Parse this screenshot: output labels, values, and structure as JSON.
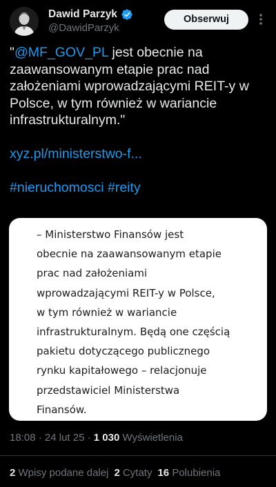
{
  "author": {
    "display_name": "Dawid Parzyk",
    "handle": "@DawidParzyk",
    "verified_color": "#1d9bf0"
  },
  "follow_button": {
    "label": "Obserwuj"
  },
  "more_icon": "more-options-icon",
  "tweet": {
    "quote_open": "\"",
    "mention": "@MF_GOV_PL",
    "text_after_mention": " jest obecnie na zaawansowanym etapie prac nad założeniami wprowadzającymi REIT-y w Polsce, w tym również w wariancie infrastrukturalnym.\"",
    "link": "xyz.pl/ministerstwo-f...",
    "hashtags": [
      "#nieruchomosci",
      "#reity"
    ]
  },
  "media": {
    "lines": [
      "– Ministerstwo Finansów jest",
      "obecnie na zaawansowanym etapie",
      "prac nad założeniami",
      "wprowadzającymi REIT-y w Polsce,",
      "w tym również w wariancie",
      "infrastrukturalnym. Będą one częścią",
      "pakietu dotyczącego publicznego",
      "rynku kapitałowego – relacjonuje",
      "przedstawiciel Ministerstwa",
      "Finansów."
    ]
  },
  "meta": {
    "time": "18:08",
    "date": "24 lut 25",
    "separator": " · ",
    "views_count": "1 030",
    "views_label": "Wyświetlenia"
  },
  "stats": {
    "reposts_count": "2",
    "reposts_label": "Wpisy podane dalej",
    "quotes_count": "2",
    "quotes_label": "Cytaty",
    "likes_count": "16",
    "likes_label": "Polubienia"
  },
  "colors": {
    "background": "#000000",
    "text": "#e7e9ea",
    "muted": "#71767b",
    "link": "#1d9bf0"
  }
}
